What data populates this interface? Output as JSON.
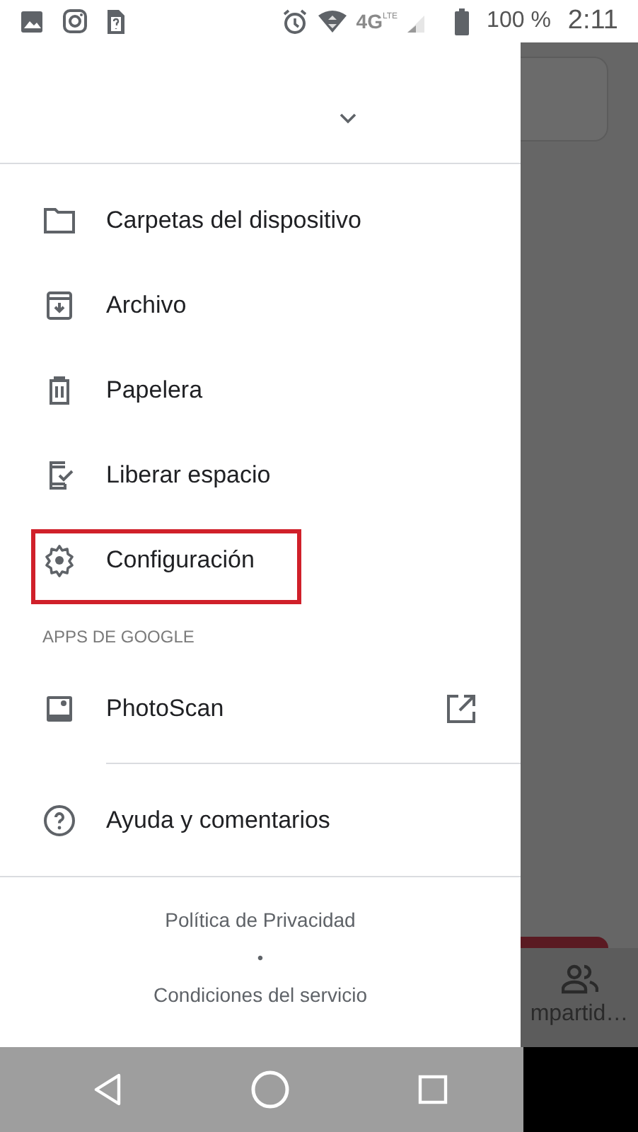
{
  "status_bar": {
    "network_label": "4G",
    "network_sublabel": "LTE",
    "battery": "100 %",
    "time": "2:11"
  },
  "drawer": {
    "header": {
      "expanded": false
    },
    "items": [
      {
        "kind": "folder",
        "label": "Carpetas del dispositivo",
        "highlighted": false
      },
      {
        "kind": "archive",
        "label": "Archivo",
        "highlighted": false
      },
      {
        "kind": "trash",
        "label": "Papelera",
        "highlighted": false
      },
      {
        "kind": "phone-check",
        "label": "Liberar espacio",
        "highlighted": false
      },
      {
        "kind": "gear",
        "label": "Configuración",
        "highlighted": true
      }
    ],
    "section_title": "APPS DE GOOGLE",
    "apps": [
      {
        "kind": "photo",
        "label": "PhotoScan",
        "external": true
      }
    ],
    "help_items": [
      {
        "kind": "help",
        "label": "Ayuda y comentarios"
      }
    ],
    "footer": {
      "links": [
        "Política de Privacidad",
        "Condiciones del servicio"
      ],
      "separator": "•"
    }
  },
  "background": {
    "tab_label": "mpartid…"
  }
}
